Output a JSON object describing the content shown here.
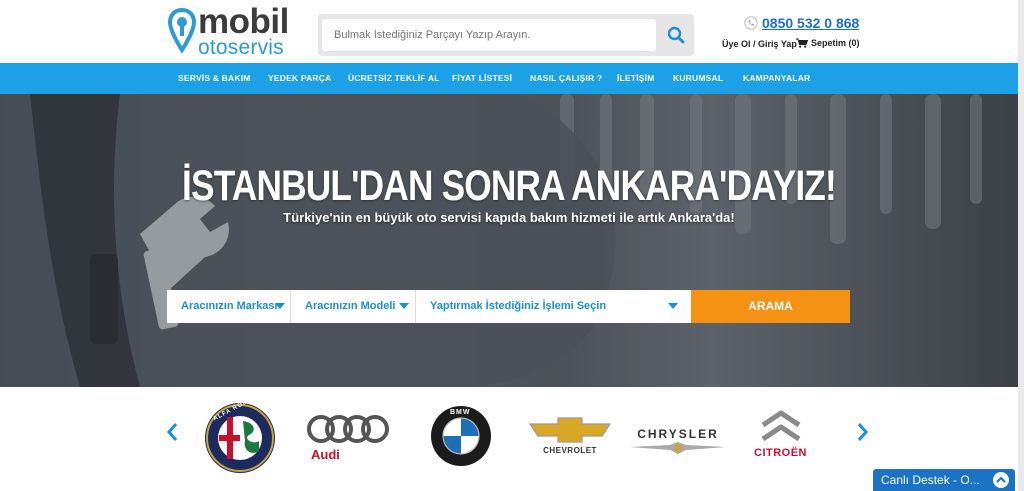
{
  "header": {
    "logo_line1": "mobil",
    "logo_line2": "otoservis",
    "search_placeholder": "Bulmak İstediğiniz Parçayı Yazıp Arayın.",
    "phone": "0850 532 0 868",
    "account": "Üye Ol / Giriş Yap",
    "cart": "Sepetim (0)"
  },
  "nav": {
    "items": [
      "SERVİS & BAKIM",
      "YEDEK PARÇA",
      "ÜCRETSİZ TEKLİF AL",
      "FİYAT LİSTESİ",
      "NASIL ÇALIŞIR ?",
      "İLETİŞİM",
      "KURUMSAL",
      "KAMPANYALAR"
    ]
  },
  "hero": {
    "title": "İSTANBUL'DAN SONRA ANKARA'DAYIZ!",
    "subtitle": "Türkiye'nin en büyük oto servisi  kapıda bakım hizmeti ile artık Ankara'da!",
    "brand_select": "Aracınızın Markası",
    "model_select": "Aracınızın Modeli",
    "service_select": "Yaptırmak İstediğiniz İşlemi Seçin",
    "search_button": "ARAMA"
  },
  "brands": {
    "items": [
      "ALFA ROMEO",
      "Audi",
      "BMW",
      "CHEVROLET",
      "CHRYSLER",
      "CITROËN"
    ]
  },
  "chat": {
    "label": "Canlı Destek - O..."
  },
  "colors": {
    "primary": "#1da1e6",
    "accent": "#f59213",
    "link": "#1c6fd0",
    "chat": "#1b73c8"
  }
}
